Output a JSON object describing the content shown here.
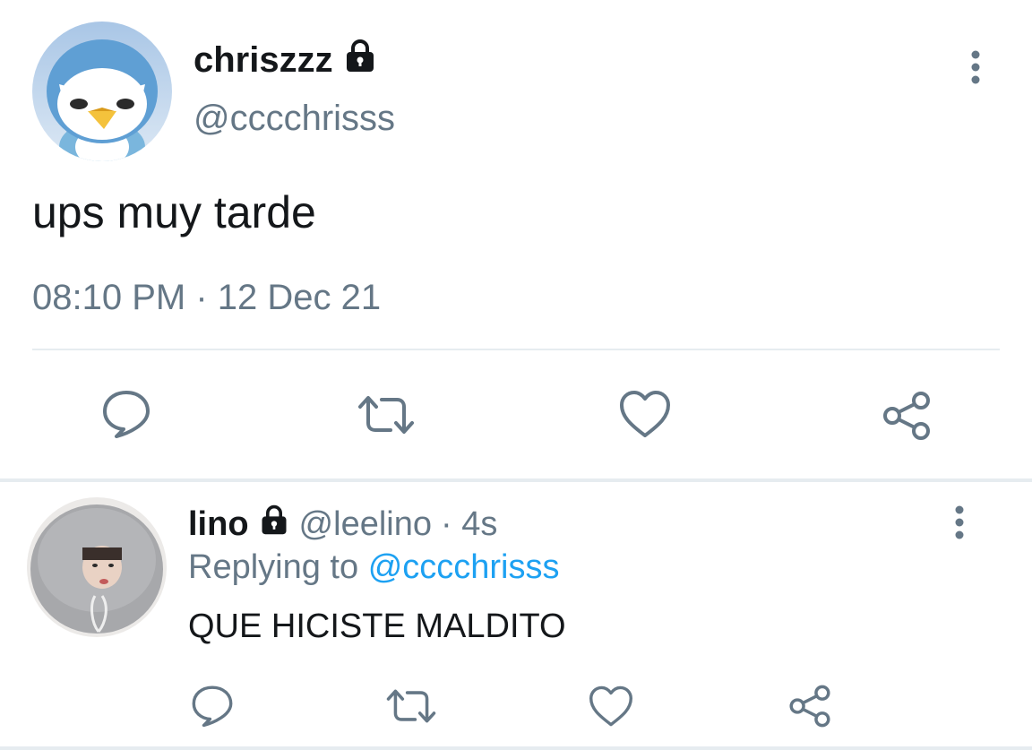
{
  "tweet": {
    "author": {
      "display_name": "chriszzz",
      "handle": "@cccchrisss",
      "protected": true,
      "avatar": "piplup-avatar"
    },
    "text": "ups muy tarde",
    "timestamp": "08:10 PM · 12 Dec 21",
    "actions": [
      "reply-icon",
      "retweet-icon",
      "like-icon",
      "share-icon"
    ]
  },
  "reply": {
    "author": {
      "display_name": "lino",
      "handle": "@leelino",
      "time": "· 4s",
      "protected": true,
      "avatar": "hooded-person-avatar"
    },
    "replying_label": "Replying to",
    "replying_to": "@cccchrisss",
    "text": "QUE HICISTE MALDITO",
    "actions": [
      "reply-icon",
      "retweet-icon",
      "like-icon",
      "share-icon"
    ]
  },
  "colors": {
    "text": "#14171a",
    "secondary": "#657786",
    "accent": "#1da1f2",
    "divider": "#e6ecf0"
  }
}
